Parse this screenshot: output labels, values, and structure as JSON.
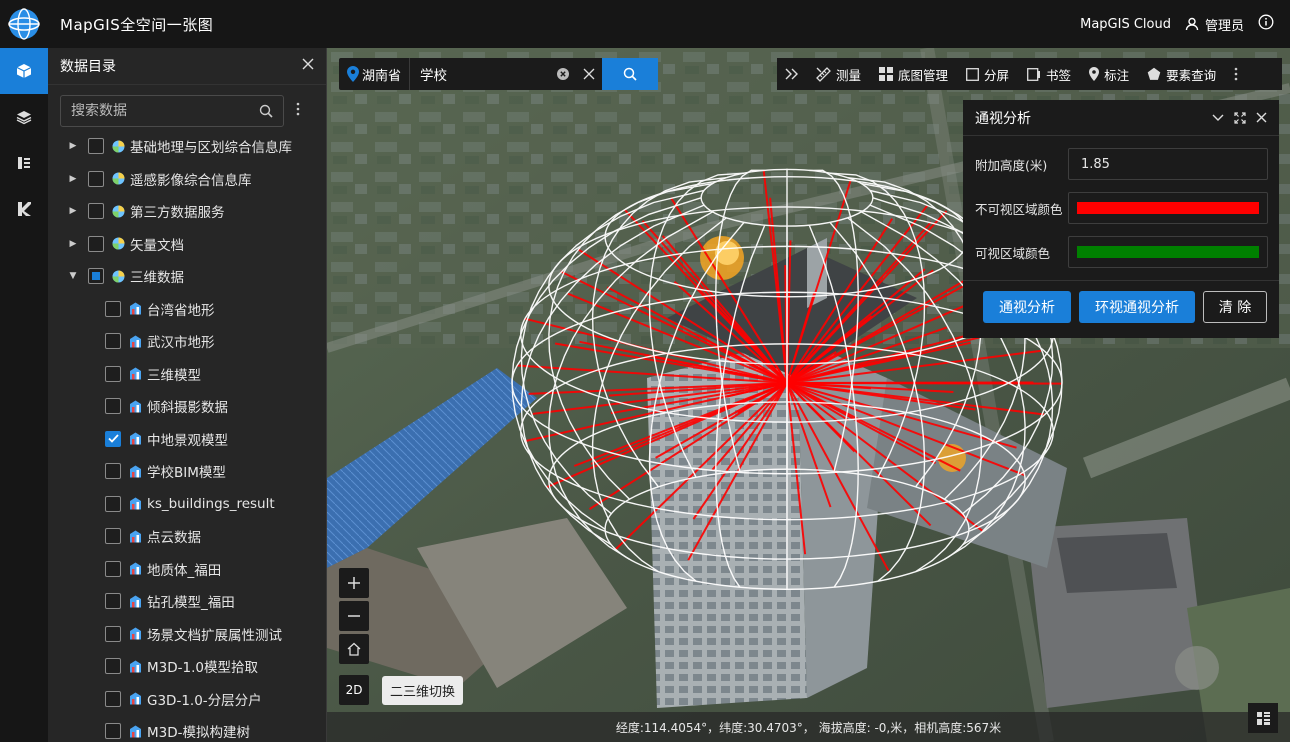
{
  "header": {
    "title": "MapGIS全空间一张图",
    "cloud": "MapGIS Cloud",
    "user": "管理员"
  },
  "rail": [
    "cube-icon",
    "layers-icon",
    "list-icon",
    "brand-k-icon"
  ],
  "panel": {
    "title": "数据目录",
    "search_placeholder": "搜索数据",
    "tree": [
      {
        "label": "基础地理与区划综合信息库",
        "level": 0,
        "state": "unchecked"
      },
      {
        "label": "遥感影像综合信息库",
        "level": 0,
        "state": "unchecked"
      },
      {
        "label": "第三方数据服务",
        "level": 0,
        "state": "unchecked"
      },
      {
        "label": "矢量文档",
        "level": 0,
        "state": "unchecked"
      },
      {
        "label": "三维数据",
        "level": 0,
        "state": "partial",
        "expanded": true
      },
      {
        "label": "台湾省地形",
        "level": 1,
        "state": "unchecked"
      },
      {
        "label": "武汉市地形",
        "level": 1,
        "state": "unchecked"
      },
      {
        "label": "三维模型",
        "level": 1,
        "state": "unchecked"
      },
      {
        "label": "倾斜摄影数据",
        "level": 1,
        "state": "unchecked"
      },
      {
        "label": "中地景观模型",
        "level": 1,
        "state": "checked"
      },
      {
        "label": "学校BIM模型",
        "level": 1,
        "state": "unchecked"
      },
      {
        "label": "ks_buildings_result",
        "level": 1,
        "state": "unchecked"
      },
      {
        "label": "点云数据",
        "level": 1,
        "state": "unchecked"
      },
      {
        "label": "地质体_福田",
        "level": 1,
        "state": "unchecked"
      },
      {
        "label": "钻孔模型_福田",
        "level": 1,
        "state": "unchecked"
      },
      {
        "label": "场景文档扩展属性测试",
        "level": 1,
        "state": "unchecked"
      },
      {
        "label": "M3D-1.0模型拾取",
        "level": 1,
        "state": "unchecked"
      },
      {
        "label": "G3D-1.0-分层分户",
        "level": 1,
        "state": "unchecked"
      },
      {
        "label": "M3D-模拟构建树",
        "level": 1,
        "state": "unchecked"
      }
    ]
  },
  "search": {
    "region": "湖南省",
    "query": "学校"
  },
  "toolbar": [
    {
      "label": "测量",
      "icon": "ruler-icon"
    },
    {
      "label": "底图管理",
      "icon": "grid-icon"
    },
    {
      "label": "分屏",
      "icon": "split-icon"
    },
    {
      "label": "书签",
      "icon": "bookmark-icon"
    },
    {
      "label": "标注",
      "icon": "pin-icon"
    },
    {
      "label": "要素查询",
      "icon": "pentagon-icon"
    }
  ],
  "analysis": {
    "title": "通视分析",
    "height_label": "附加高度(米)",
    "height_value": "1.85",
    "invisible_label": "不可视区域颜色",
    "invisible_color": "#ff0000",
    "visible_label": "可视区域颜色",
    "visible_color": "#008000",
    "btn_los": "通视分析",
    "btn_ring": "环视通视分析",
    "btn_clear": "清 除"
  },
  "map": {
    "toggle_2d": "2D",
    "tooltip": "二三维切换",
    "status": "经度:114.4054°，纬度:30.4703°， 海拔高度: -0,米，相机高度:567米"
  }
}
